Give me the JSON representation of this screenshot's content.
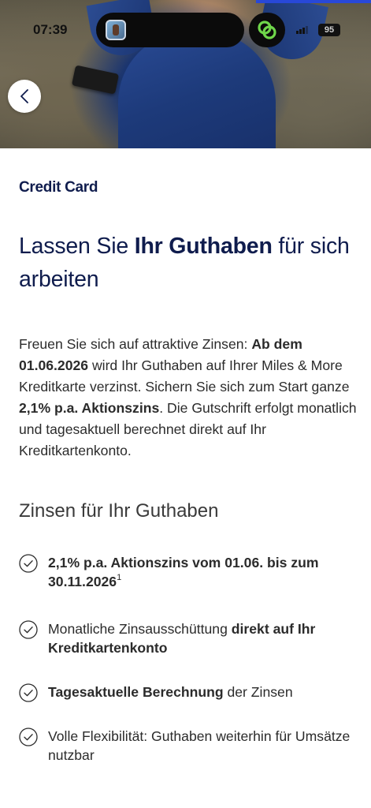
{
  "status_bar": {
    "time": "07:39",
    "battery": "95"
  },
  "icons": {
    "back": "chevron-left-icon",
    "app_badge": "linked-rings-icon",
    "check": "check-circle-icon"
  },
  "colors": {
    "brand_navy": "#0f1c4d",
    "app_badge_green": "#6fd64a",
    "hero_shirt_blue": "#1d3a7a"
  },
  "brand": {
    "title": "Credit Card"
  },
  "headline": {
    "part1": "Lassen Sie ",
    "bold": "Ihr Guthaben",
    "part2": " für sich arbeiten"
  },
  "intro": {
    "t1": "Freuen Sie sich auf attraktive Zinsen: ",
    "b1": "Ab dem 01.06.2026",
    "t2": " wird Ihr Guthaben auf Ihrer Miles & More Kreditkarte verzinst. Sichern Sie sich zum Start ganze ",
    "b2": "2,1% p.a. Aktionszins",
    "t3": ". Die Gutschrift erfolgt monatlich und tagesaktuell berechnet direkt auf Ihr Kreditkartenkonto."
  },
  "section": {
    "title": "Zinsen für Ihr Guthaben"
  },
  "benefits": [
    {
      "bold": "2,1% p.a. Aktionszins vom 01.06. bis zum 30.11.2026",
      "footnote": "1"
    },
    {
      "normal": "Monatliche Zinsausschüttung ",
      "bold": "direkt auf Ihr Kreditkartenkonto"
    },
    {
      "bold": "Tagesaktuelle Berechnung",
      "normal": " der Zinsen"
    },
    {
      "normal": "Volle Flexibilität: Guthaben weiterhin für Umsätze nutzbar"
    }
  ]
}
